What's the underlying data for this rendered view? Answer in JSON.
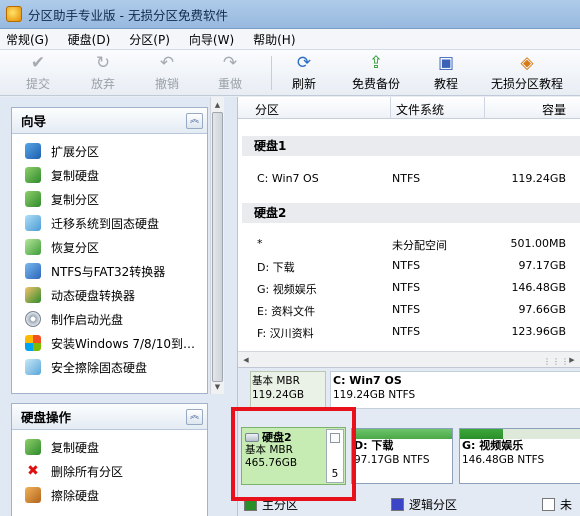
{
  "window": {
    "title": "分区助手专业版 - 无损分区免费软件"
  },
  "menu": [
    "常规(G)",
    "硬盘(D)",
    "分区(P)",
    "向导(W)",
    "帮助(H)"
  ],
  "toolbar": {
    "commit": "提交",
    "discard": "放弃",
    "undo": "撤销",
    "redo": "重做",
    "refresh": "刷新",
    "backup": "免费备份",
    "tutorial": "教程",
    "partition_tutorial": "无损分区教程"
  },
  "wizard_panel": {
    "title": "向导",
    "items": [
      "扩展分区",
      "复制硬盘",
      "复制分区",
      "迁移系统到固态硬盘",
      "恢复分区",
      "NTFS与FAT32转换器",
      "动态硬盘转换器",
      "制作启动光盘",
      "安装Windows 7/8/10到…",
      "安全擦除固态硬盘"
    ]
  },
  "disk_ops_panel": {
    "title": "硬盘操作",
    "items": [
      "复制硬盘",
      "删除所有分区",
      "擦除硬盘"
    ]
  },
  "table": {
    "col_partition": "分区",
    "col_filesystem": "文件系统",
    "col_capacity": "容量",
    "disk1": {
      "label": "硬盘1",
      "rows": [
        {
          "name": "C: Win7 OS",
          "fs": "NTFS",
          "size": "119.24GB"
        }
      ]
    },
    "disk2": {
      "label": "硬盘2",
      "rows": [
        {
          "name": "*",
          "fs": "未分配空间",
          "size": "501.00MB"
        },
        {
          "name": "D: 下载",
          "fs": "NTFS",
          "size": "97.17GB"
        },
        {
          "name": "G: 视频娱乐",
          "fs": "NTFS",
          "size": "146.48GB"
        },
        {
          "name": "E: 资料文件",
          "fs": "NTFS",
          "size": "97.66GB"
        },
        {
          "name": "F: 汉川资料",
          "fs": "NTFS",
          "size": "123.96GB"
        }
      ]
    }
  },
  "diskmap": {
    "disk1": {
      "type": "基本 MBR",
      "size": "119.24GB",
      "part_name": "C: Win7 OS",
      "part_info": "119.24GB NTFS"
    },
    "disk2": {
      "name": "硬盘2",
      "type": "基本 MBR",
      "size": "465.76GB",
      "unalloc_label": "5"
    },
    "disk2_parts": [
      {
        "name": "D: 下载",
        "info": "97.17GB NTFS"
      },
      {
        "name": "G: 视频娱乐",
        "info": "146.48GB NTFS"
      }
    ]
  },
  "legend": {
    "primary": "主分区",
    "logical": "逻辑分区",
    "unalloc": "未"
  },
  "colors": {
    "accent_red": "#e8101b",
    "primary_green": "#2b8f29",
    "logical_blue": "#3b46c7"
  }
}
